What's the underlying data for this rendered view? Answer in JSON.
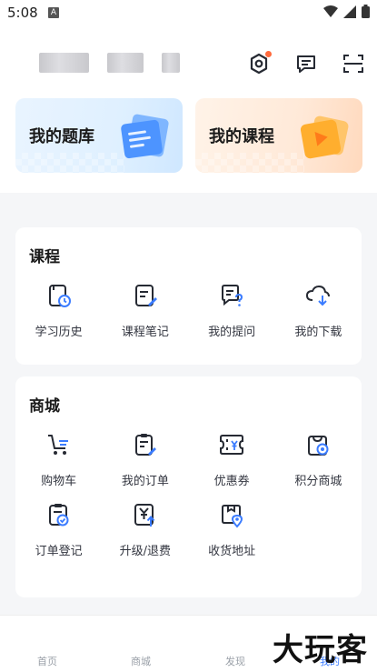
{
  "status": {
    "time": "5:08",
    "notice": "A"
  },
  "header": {
    "settings_icon": "gear-hex-icon",
    "message_icon": "message-icon",
    "scan_icon": "scan-icon",
    "accent": "#ff6a3c"
  },
  "cards": [
    {
      "title": "我的题库",
      "icon": "folder-icon"
    },
    {
      "title": "我的课程",
      "icon": "play-icon"
    }
  ],
  "course": {
    "title": "课程",
    "items": [
      {
        "label": "学习历史",
        "icon": "history-icon"
      },
      {
        "label": "课程笔记",
        "icon": "note-icon"
      },
      {
        "label": "我的提问",
        "icon": "question-icon"
      },
      {
        "label": "我的下载",
        "icon": "download-icon"
      }
    ]
  },
  "mall": {
    "title": "商城",
    "items": [
      {
        "label": "购物车",
        "icon": "cart-icon"
      },
      {
        "label": "我的订单",
        "icon": "order-icon"
      },
      {
        "label": "优惠券",
        "icon": "coupon-icon"
      },
      {
        "label": "积分商城",
        "icon": "points-icon"
      },
      {
        "label": "订单登记",
        "icon": "register-icon"
      },
      {
        "label": "升级/退费",
        "icon": "upgrade-icon"
      },
      {
        "label": "收货地址",
        "icon": "address-icon"
      }
    ]
  },
  "tabs": [
    {
      "label": "首页"
    },
    {
      "label": "商城"
    },
    {
      "label": "发现"
    },
    {
      "label": "我的"
    }
  ],
  "watermark": "大玩客",
  "colors": {
    "primary": "#3b7cff",
    "text": "#1c1f26"
  }
}
